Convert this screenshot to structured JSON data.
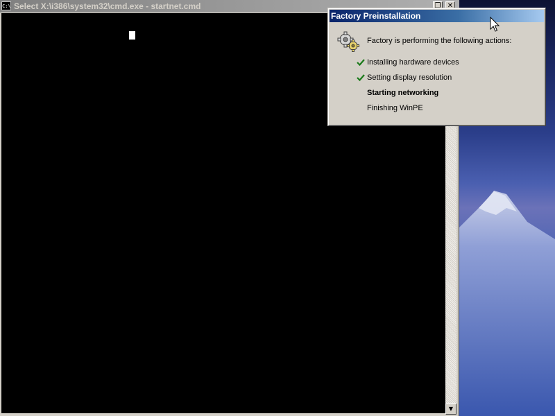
{
  "cmd_window": {
    "title": "Select X:\\i386\\system32\\cmd.exe - startnet.cmd",
    "icon_text": "C:\\"
  },
  "factory_dialog": {
    "title": "Factory Preinstallation",
    "header": "Factory is performing the following actions:",
    "steps": [
      {
        "label": "Installing hardware devices",
        "status": "done"
      },
      {
        "label": "Setting display resolution",
        "status": "done"
      },
      {
        "label": "Starting networking",
        "status": "in-progress"
      },
      {
        "label": "Finishing WinPE",
        "status": "pending"
      }
    ]
  },
  "icons": {
    "cmd_icon": "console-icon",
    "dialog_icon": "gears-icon",
    "check": "checkmark-icon",
    "cursor": "mouse-pointer-icon"
  },
  "colors": {
    "title_active": "#0a246a",
    "title_inactive": "#808080",
    "dialog_bg": "#d4d0c8",
    "console_bg": "#000000",
    "check_green": "#1a7a1a"
  }
}
